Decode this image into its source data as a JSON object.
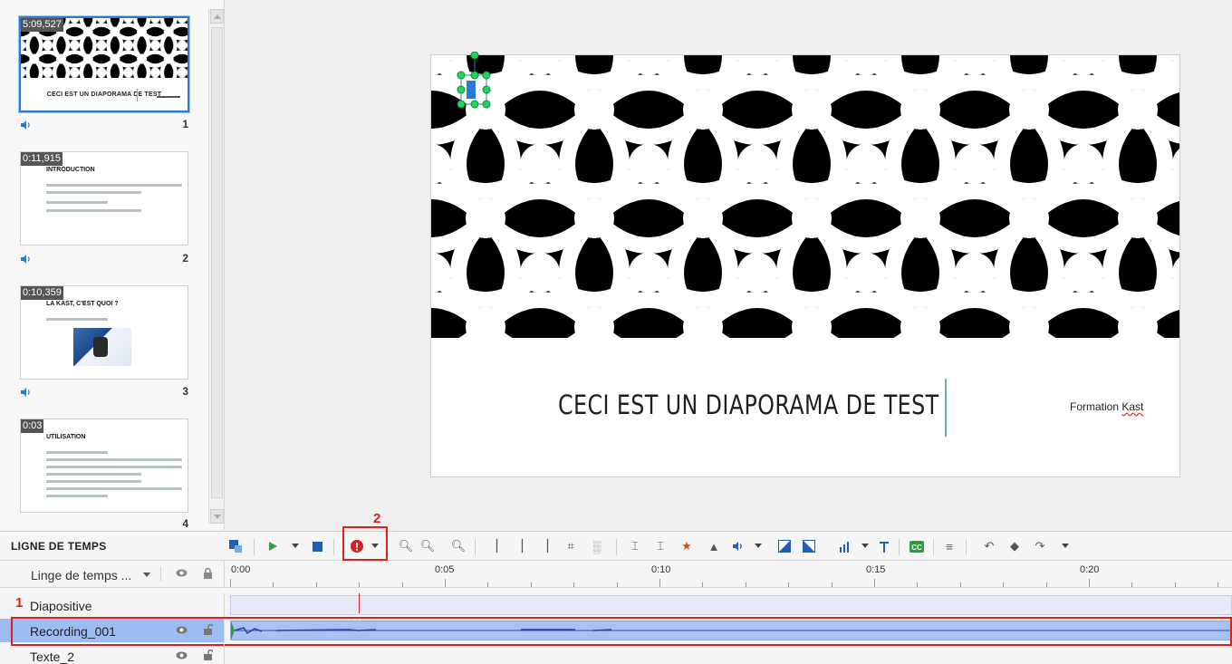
{
  "slides": [
    {
      "number": "1",
      "time": "5:09,527",
      "title": "CECI EST UN DIAPORAMA DE TEST",
      "selected": true
    },
    {
      "number": "2",
      "time": "0:11,915",
      "title": "INTRODUCTION"
    },
    {
      "number": "3",
      "time": "0:10,359",
      "title": "LA KAST, C'EST QUOI ?"
    },
    {
      "number": "4",
      "time": "0:03",
      "title": "UTILISATION"
    }
  ],
  "stage": {
    "title": "CECI EST UN DIAPORAMA DE TEST",
    "subtitle_part1": "Formation ",
    "subtitle_part2": "Kast"
  },
  "timeline": {
    "heading": "LIGNE DE TEMPS",
    "track_filter": "Linge de temps ...",
    "ruler": [
      "0:00",
      "0:05",
      "0:10",
      "0:15",
      "0:20"
    ],
    "tracks": [
      {
        "name": "Diapositive"
      },
      {
        "name": "Recording_001",
        "selected": true
      },
      {
        "name": "Texte_2"
      }
    ]
  },
  "annotations": {
    "one": "1",
    "two": "2"
  },
  "colors": {
    "selection": "#2b79d6",
    "annotation": "#e01e1e",
    "play": "#2aa837",
    "record": "#d62020",
    "cc": "#2e9b3e"
  }
}
